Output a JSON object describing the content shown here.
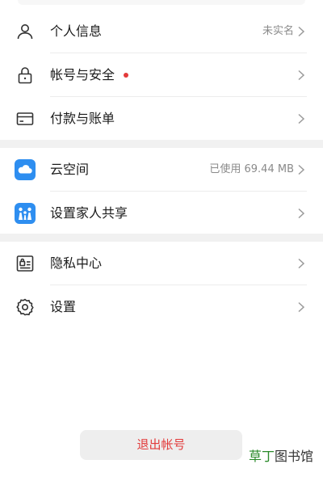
{
  "groups": [
    {
      "items": [
        {
          "icon": "person-icon",
          "label": "个人信息",
          "value": "未实名"
        },
        {
          "icon": "lock-icon",
          "label": "帐号与安全",
          "value": "",
          "badge": "red-dot"
        },
        {
          "icon": "card-icon",
          "label": "付款与账单",
          "value": ""
        }
      ]
    },
    {
      "items": [
        {
          "icon": "cloud-icon",
          "label": "云空间",
          "value": "已使用 69.44 MB"
        },
        {
          "icon": "family-icon",
          "label": "设置家人共享",
          "value": ""
        }
      ]
    },
    {
      "items": [
        {
          "icon": "privacy-icon",
          "label": "隐私中心",
          "value": ""
        },
        {
          "icon": "gear-icon",
          "label": "设置",
          "value": ""
        }
      ]
    }
  ],
  "logout": {
    "label": "退出帐号"
  },
  "watermark": {
    "part_a": "草丁",
    "part_b": "图书馆"
  },
  "colors": {
    "accent_red": "#e33b3b",
    "cloud_blue": "#2e8ef0",
    "divider": "#ececec",
    "separator": "#f1f1f1"
  }
}
